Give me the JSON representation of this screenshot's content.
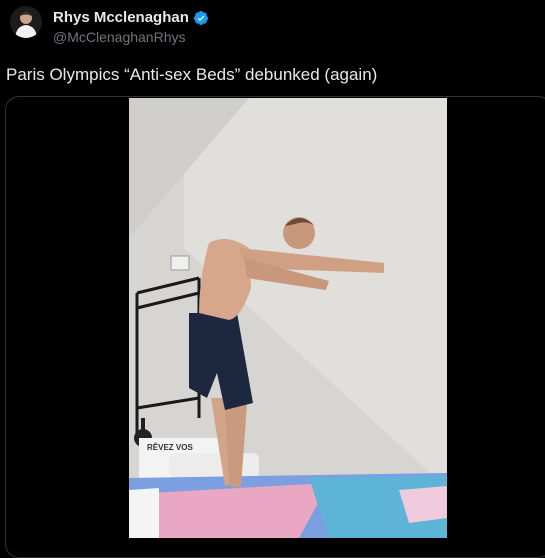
{
  "author": {
    "display_name": "Rhys Mcclenaghan",
    "handle": "@McClenaghanRhys",
    "verified": true,
    "verified_color": "#1d9bf0"
  },
  "tweet": {
    "text": "Paris Olympics “Anti-sex Beds” debunked (again)"
  },
  "media": {
    "type": "video",
    "box_label_text": "RÊVEZ VOS"
  },
  "colors": {
    "background": "#000000",
    "text_primary": "#e7e9ea",
    "text_secondary": "#71767b",
    "border": "#2f3336"
  }
}
